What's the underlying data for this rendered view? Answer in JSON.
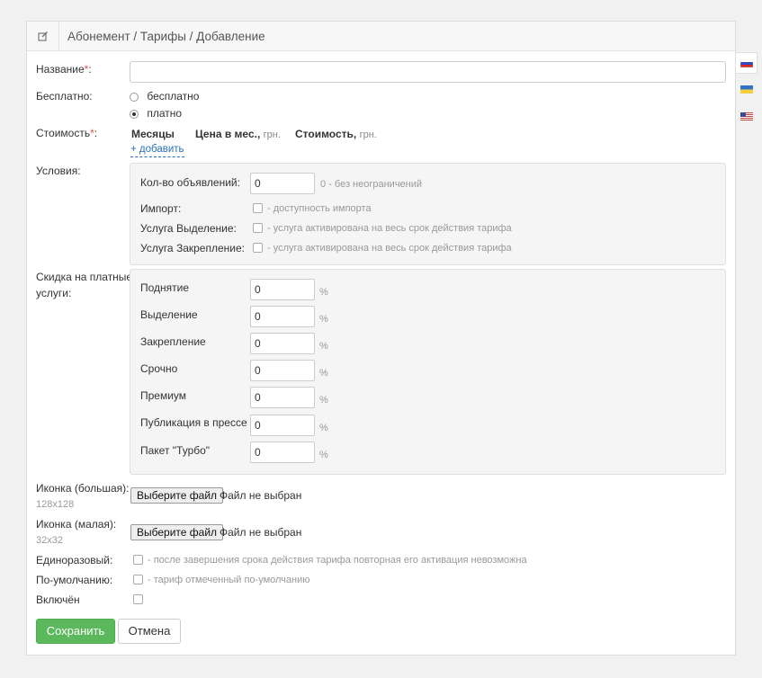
{
  "header": {
    "breadcrumb": "Абонемент / Тарифы / Добавление"
  },
  "form": {
    "name": {
      "label": "Название",
      "required": "*",
      "colon": ":"
    },
    "free": {
      "label": "Бесплатно:",
      "options": [
        "бесплатно",
        "платно"
      ],
      "selected": "платно"
    },
    "cost": {
      "label": "Стоимость",
      "required": "*",
      "colon": ":",
      "col_months": "Месяцы",
      "col_price": "Цена в мес.,",
      "col_price_unit": "грн.",
      "col_total": "Стоимость,",
      "col_total_unit": "грн.",
      "add_link": "+ добавить"
    },
    "conditions": {
      "label": "Условия:",
      "ads_count": {
        "label": "Кол-во объявлений:",
        "value": "0",
        "hint": "0 - без неограничений"
      },
      "import": {
        "label": "Импорт:",
        "hint": "- доступность импорта"
      },
      "highlight": {
        "label": "Услуга Выделение:",
        "hint": "- услуга активирована на весь срок действия тарифа"
      },
      "pin": {
        "label": "Услуга Закрепление:",
        "hint": "- услуга активирована на весь срок действия тарифа"
      }
    },
    "discount": {
      "label_line1": "Скидка на платные",
      "label_line2": "услуги:",
      "unit": "%",
      "items": [
        {
          "label": "Поднятие",
          "value": "0"
        },
        {
          "label": "Выделение",
          "value": "0"
        },
        {
          "label": "Закрепление",
          "value": "0"
        },
        {
          "label": "Срочно",
          "value": "0"
        },
        {
          "label": "Премиум",
          "value": "0"
        },
        {
          "label": "Публикация в прессе",
          "value": "0"
        },
        {
          "label": "Пакет \"Турбо\"",
          "value": "0"
        }
      ]
    },
    "icon_big": {
      "label": "Иконка (большая):",
      "size": "128x128",
      "button": "Выберите файл",
      "status": "Файл не выбран"
    },
    "icon_small": {
      "label": "Иконка (малая):",
      "size": "32x32",
      "button": "Выберите файл",
      "status": "Файл не выбран"
    },
    "one_time": {
      "label": "Единоразовый:",
      "hint": "- после завершения срока действия тарифа повторная его активация невозможна"
    },
    "default": {
      "label": "По-умолчанию:",
      "hint": "- тариф отмеченный по-умолчанию"
    },
    "enabled": {
      "label": "Включён"
    }
  },
  "actions": {
    "save": "Сохранить",
    "cancel": "Отмена"
  },
  "languages": [
    "ru-flag-icon",
    "ua-flag-icon",
    "us-flag-icon"
  ]
}
